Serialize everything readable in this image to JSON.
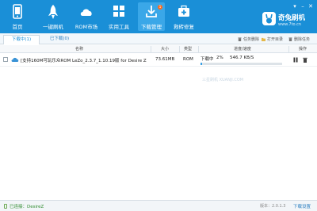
{
  "nav": {
    "items": [
      {
        "label": "首页"
      },
      {
        "label": "一键刷机"
      },
      {
        "label": "ROM市场"
      },
      {
        "label": "实用工具"
      },
      {
        "label": "下载管理",
        "badge": "1"
      },
      {
        "label": "救砖修复"
      }
    ]
  },
  "window_controls": [
    "▾",
    "–",
    "✕"
  ],
  "brand": {
    "name": "奇兔刷机",
    "url": "www.7to.cn"
  },
  "tabs": [
    {
      "label": "下载中(1)"
    },
    {
      "label": "已下载(0)"
    }
  ],
  "tab_actions": {
    "clear": "任务删除",
    "open_dir": "打开目录",
    "delete": "删除任务"
  },
  "table": {
    "columns": [
      "名称",
      "大小",
      "类型",
      "进度/速度",
      "操作"
    ],
    "rows": [
      {
        "name": "[支持160M可玩乐众ROM LeZo_2.3.7_1.10.19版 for Desire Z",
        "size": "73.61MB",
        "type": "ROM",
        "status": "下载中",
        "percent_text": "2%",
        "progress": 0.02,
        "speed": "546.7 KB/S"
      }
    ]
  },
  "watermark": "三星刷机 XUANJI.COM",
  "status_bar": {
    "connection": "已连接：DesireZ",
    "version": "版本：2.0.1.3",
    "download_settings": "下载设置"
  },
  "colors": {
    "topbar": "#1a8fd7",
    "accent": "#3aa0e4",
    "connected": "#2e8b2e"
  }
}
